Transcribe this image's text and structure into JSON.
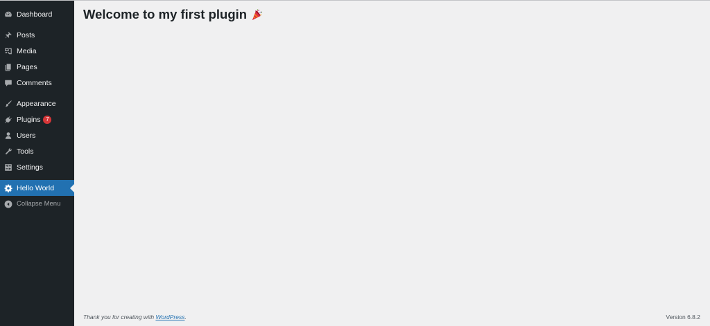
{
  "sidebar": {
    "items": [
      {
        "label": "Dashboard",
        "icon": "dashboard-icon"
      },
      {
        "label": "Posts",
        "icon": "pushpin-icon"
      },
      {
        "label": "Media",
        "icon": "media-icon"
      },
      {
        "label": "Pages",
        "icon": "pages-icon"
      },
      {
        "label": "Comments",
        "icon": "comment-bubble-icon"
      },
      {
        "label": "Appearance",
        "icon": "paintbrush-icon"
      },
      {
        "label": "Plugins",
        "icon": "plugin-icon",
        "badge": "7"
      },
      {
        "label": "Users",
        "icon": "user-icon"
      },
      {
        "label": "Tools",
        "icon": "wrench-icon"
      },
      {
        "label": "Settings",
        "icon": "settings-sliders-icon"
      },
      {
        "label": "Hello World",
        "icon": "gear-icon",
        "current": true
      },
      {
        "label": "Collapse Menu",
        "icon": "collapse-arrow-icon"
      }
    ]
  },
  "main": {
    "title": "Welcome to my first plugin",
    "title_icon": "party-popper-emoji"
  },
  "footer": {
    "thanks_prefix": "Thank you for creating with",
    "thanks_link": "WordPress",
    "thanks_suffix": ".",
    "version": "Version 6.8.2"
  },
  "colors": {
    "sidebar_bg": "#1d2327",
    "accent": "#2271b1",
    "badge": "#d63638",
    "content_bg": "#f0f0f1"
  }
}
